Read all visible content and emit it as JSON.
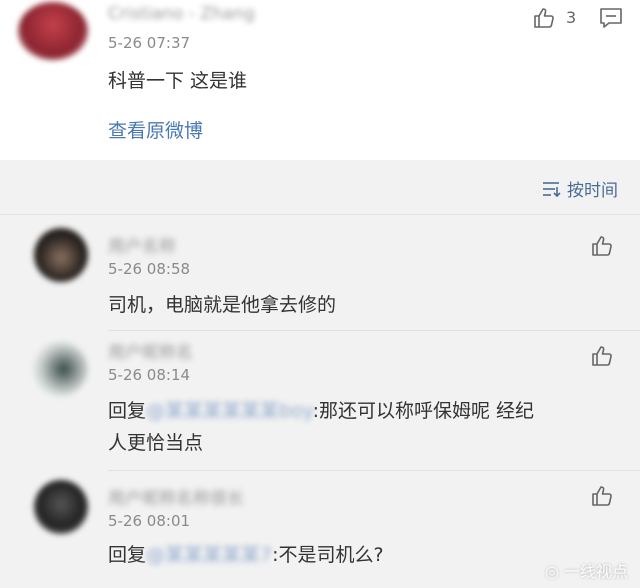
{
  "top_comment": {
    "author": "Cristiano - Zhang",
    "time": "5-26 07:37",
    "text": "科普一下 这是谁",
    "like_count": "3",
    "view_original": "查看原微博"
  },
  "sort": {
    "label": "按时间"
  },
  "replies": [
    {
      "author": "用户名称",
      "time": "5-26 08:58",
      "text": "司机，电脑就是他拿去修的"
    },
    {
      "author": "用户昵称名",
      "time": "5-26 08:14",
      "reply_prefix": "回复",
      "mention": "@某某某某某某boy",
      "reply_text": ":那还可以称呼保姆呢 经纪",
      "reply_text_line2": "人更恰当点"
    },
    {
      "author": "用户昵称名称很长",
      "time": "5-26 08:01",
      "reply_prefix": "回复",
      "mention": "@某某某某某7",
      "reply_text": ":不是司机么?"
    }
  ],
  "watermark": "一线视点"
}
